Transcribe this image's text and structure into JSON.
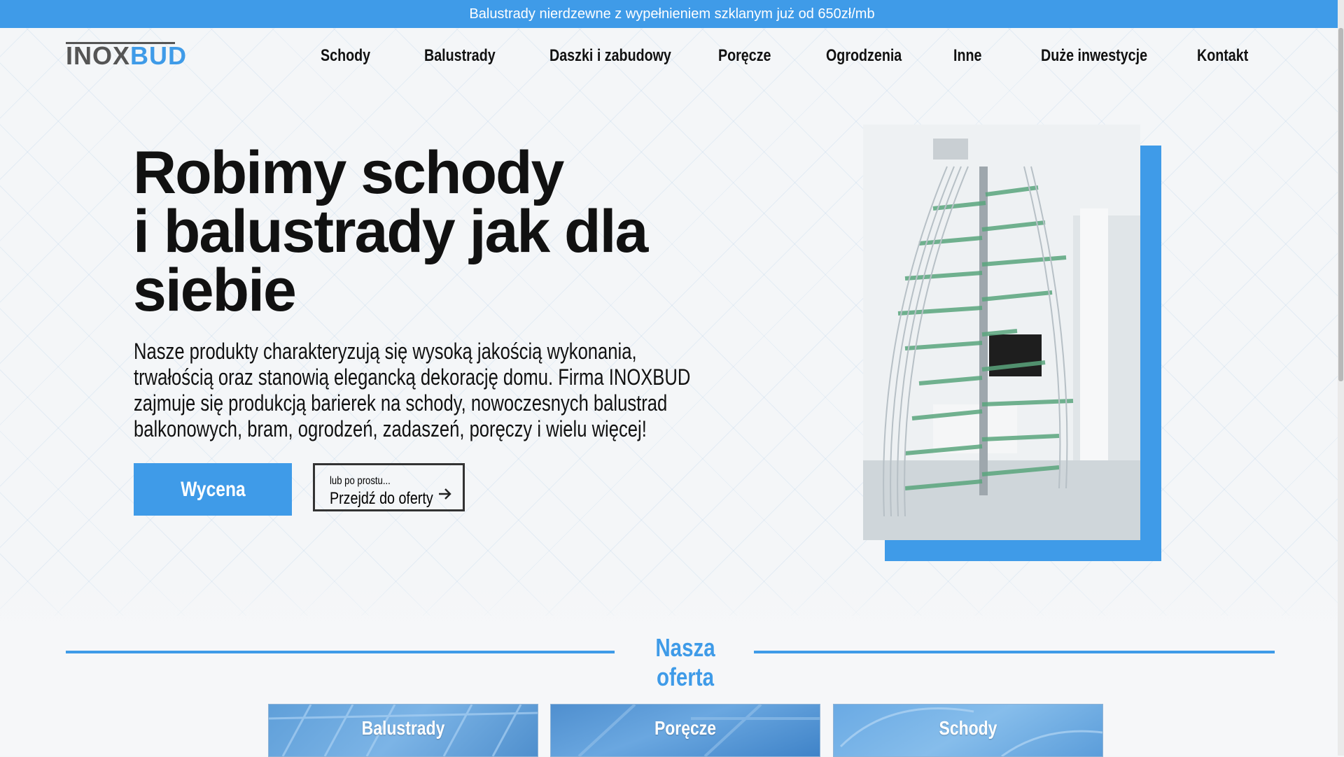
{
  "announcement": "Balustrady nierdzewne z wypełnieniem szklanym już od 650zł/mb",
  "logo": {
    "part1": "INOX",
    "part2": "BUD"
  },
  "nav": {
    "items": [
      "Schody",
      "Balustrady",
      "Daszki i zabudowy",
      "Poręcze",
      "Ogrodzenia",
      "Inne",
      "Duże inwestycje",
      "Kontakt"
    ]
  },
  "hero": {
    "title_line1": "Robimy schody",
    "title_line2": "i balustrady jak dla",
    "title_line3": "siebie",
    "description_line1": "Nasze produkty charakteryzują się wysoką jakością wykonania,",
    "description_line2": "trwałością oraz stanowią elegancką dekorację domu. Firma INOXBUD",
    "description_line3": "zajmuje się produkcją barierek na schody, nowoczesnych balustrad",
    "description_line4": "balkonowych, bram, ogrodzeń, zadaszeń, poręczy i wielu więcej!",
    "quote_button": "Wycena",
    "offer_button_small": "lub po prostu...",
    "offer_button_main": "Przejdź do oferty",
    "offer_button_icon": "arrow-right-icon"
  },
  "offer_section": {
    "title": "Nasza oferta",
    "cards": [
      {
        "label": "Balustrady"
      },
      {
        "label": "Poręcze"
      },
      {
        "label": "Schody"
      }
    ]
  },
  "colors": {
    "accent": "#3f9be8",
    "text": "#111111",
    "background": "#f4f6f8"
  }
}
